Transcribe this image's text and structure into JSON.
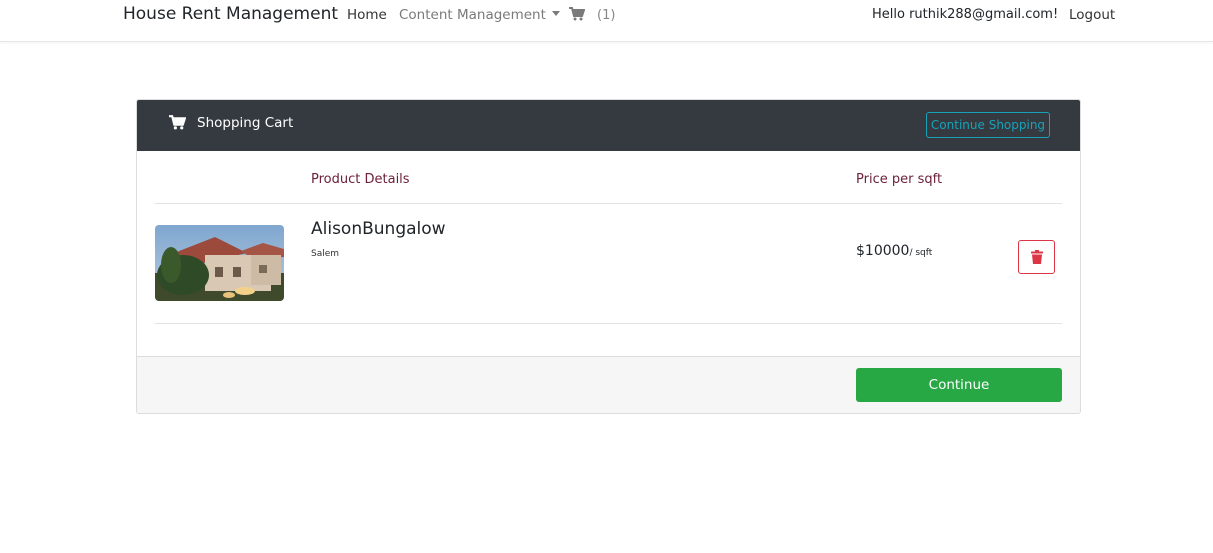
{
  "navbar": {
    "brand": "House Rent Management",
    "home_label": "Home",
    "content_management_label": "Content Management",
    "cart_count": "(1)",
    "greeting": "Hello ruthik288@gmail.com!",
    "logout_label": "Logout"
  },
  "cart": {
    "title": "Shopping Cart",
    "continue_shopping_label": "Continue Shopping",
    "columns": {
      "product": "Product Details",
      "price": "Price per sqft"
    },
    "items": [
      {
        "name": "AlisonBungalow",
        "location": "Salem",
        "price": "$10000",
        "unit": "/ sqft"
      }
    ],
    "continue_label": "Continue"
  },
  "colors": {
    "header_bg": "#343a40",
    "info": "#17a2b8",
    "danger": "#dc3545",
    "success": "#28a745",
    "column_heading": "#6b1f3a"
  },
  "icons": {
    "nav_cart": "cart-icon",
    "header_cart": "cart-icon",
    "delete": "trash-icon",
    "dropdown": "caret-down-icon"
  }
}
